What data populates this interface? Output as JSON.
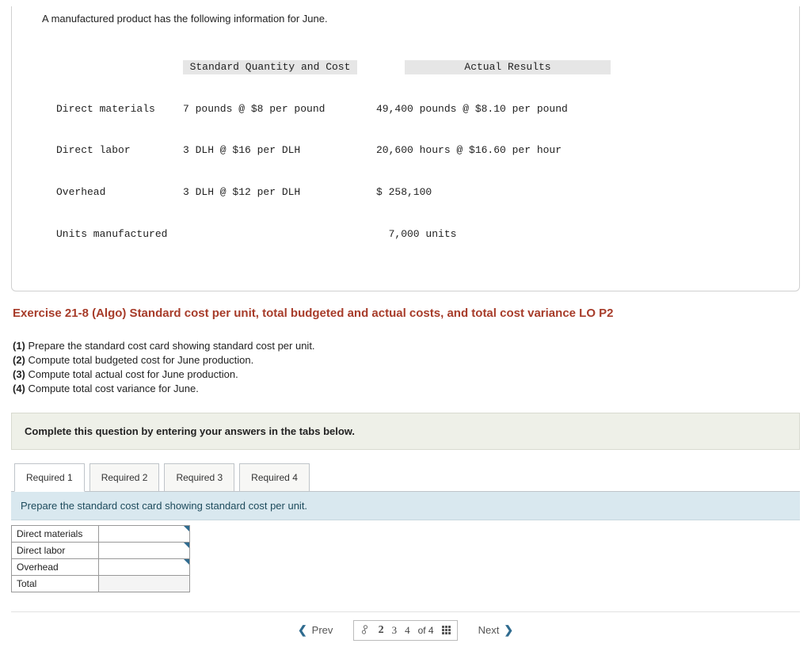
{
  "info": {
    "intro": "A manufactured product has the following information for June.",
    "headers": {
      "std": "Standard Quantity and Cost",
      "actual": "Actual Results"
    },
    "rows": {
      "dm": {
        "label": "Direct materials",
        "std": "7 pounds @ $8 per pound",
        "actual": "49,400 pounds @ $8.10 per pound"
      },
      "dl": {
        "label": "Direct labor",
        "std": "3 DLH @ $16 per DLH",
        "actual": "20,600 hours @ $16.60 per hour"
      },
      "oh": {
        "label": "Overhead",
        "std": "3 DLH @ $12 per DLH",
        "actual": "$ 258,100"
      },
      "units": {
        "label": "Units manufactured",
        "std": "",
        "actual": "  7,000 units"
      }
    }
  },
  "exercise_title": "Exercise 21-8 (Algo) Standard cost per unit, total budgeted and actual costs, and total cost variance LO P2",
  "instructions": {
    "i1b": "(1)",
    "i1": " Prepare the standard cost card showing standard cost per unit.",
    "i2b": "(2)",
    "i2": " Compute total budgeted cost for June production.",
    "i3b": "(3)",
    "i3": " Compute total actual cost for June production.",
    "i4b": "(4)",
    "i4": " Compute total cost variance for June."
  },
  "complete_msg": "Complete this question by entering your answers in the tabs below.",
  "tabs": {
    "t1": "Required 1",
    "t2": "Required 2",
    "t3": "Required 3",
    "t4": "Required 4"
  },
  "tab_instruction": "Prepare the standard cost card showing standard cost per unit.",
  "entry_rows": {
    "r1": "Direct materials",
    "r2": "Direct labor",
    "r3": "Overhead",
    "r4": "Total"
  },
  "pager": {
    "prev": "Prev",
    "next": "Next",
    "pages": {
      "p2": "2",
      "p3": "3",
      "p4": "4"
    },
    "of": "of 4"
  }
}
